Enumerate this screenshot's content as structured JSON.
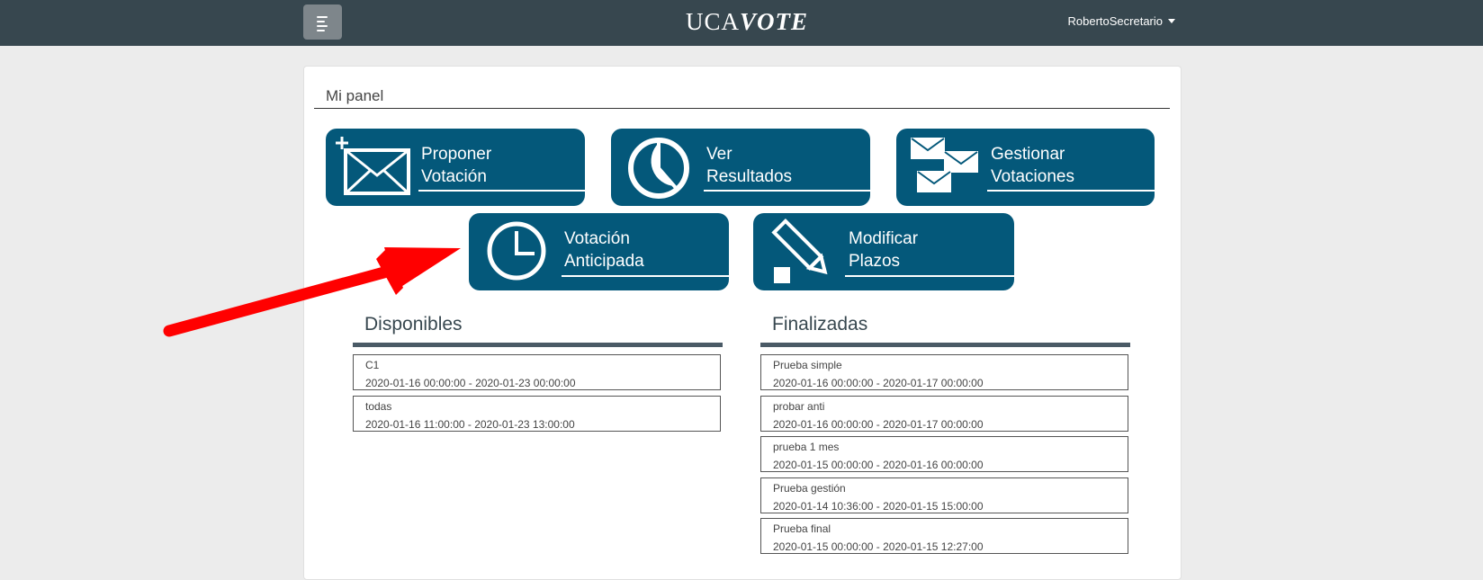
{
  "navbar": {
    "logo_part1": "UCA",
    "logo_part2": "VOTE",
    "user": "RobertoSecretario"
  },
  "panel": {
    "title": "Mi panel"
  },
  "tiles": [
    {
      "line1": "Proponer",
      "line2": "Votación"
    },
    {
      "line1": "Ver",
      "line2": "Resultados"
    },
    {
      "line1": "Gestionar",
      "line2": "Votaciones"
    },
    {
      "line1": "Votación",
      "line2": "Anticipada"
    },
    {
      "line1": "Modificar",
      "line2": "Plazos"
    }
  ],
  "disponibles": {
    "title": "Disponibles",
    "items": [
      {
        "name": "C1",
        "dates": "2020-01-16 00:00:00 - 2020-01-23 00:00:00"
      },
      {
        "name": "todas",
        "dates": "2020-01-16 11:00:00 - 2020-01-23 13:00:00"
      }
    ]
  },
  "finalizadas": {
    "title": "Finalizadas",
    "items": [
      {
        "name": "Prueba simple",
        "dates": "2020-01-16 00:00:00 - 2020-01-17 00:00:00"
      },
      {
        "name": "probar anti",
        "dates": "2020-01-16 00:00:00 - 2020-01-17 00:00:00"
      },
      {
        "name": "prueba 1 mes",
        "dates": "2020-01-15 00:00:00 - 2020-01-16 00:00:00"
      },
      {
        "name": "Prueba gestión",
        "dates": "2020-01-14 10:36:00 - 2020-01-15 15:00:00"
      },
      {
        "name": "Prueba final",
        "dates": "2020-01-15 00:00:00 - 2020-01-15 12:27:00"
      }
    ]
  },
  "colors": {
    "navbar": "#37474f",
    "tile": "#04587a",
    "arrow": "#ff0000",
    "page_bg": "#ececec"
  }
}
